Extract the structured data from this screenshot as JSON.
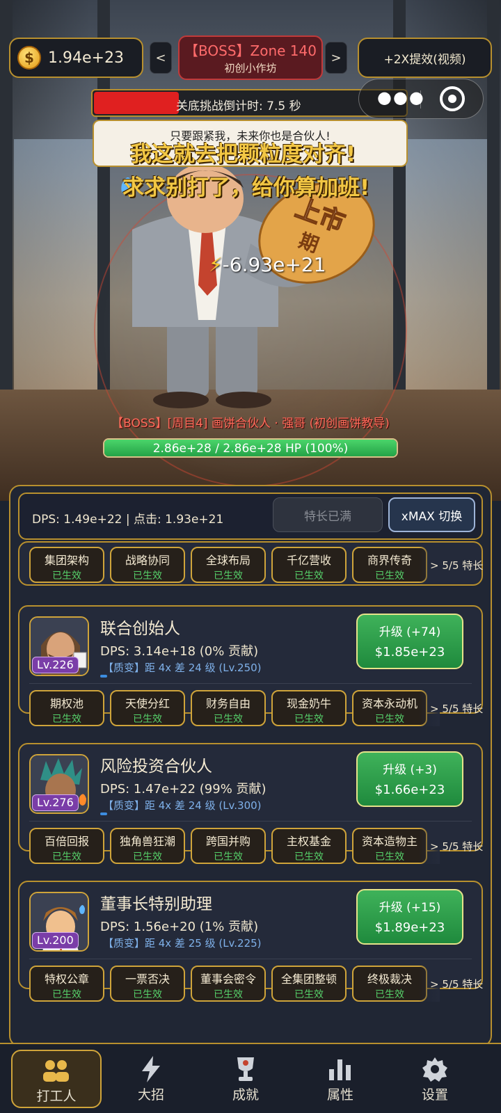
{
  "header": {
    "coins": "1.94e+23",
    "nav_prev": "<",
    "nav_next": ">",
    "zone_title": "【BOSS】Zone 140",
    "zone_subtitle": "初创小作坊",
    "video_boost": "+2X提效(视频)"
  },
  "timer": {
    "label": "关底挑战倒计时: 7.5 秒",
    "remaining_fraction": 0.27
  },
  "speech": {
    "bubble": "只要跟紧我，未来你也是合伙人!",
    "float_1": "我这就去把颗粒度对齐!",
    "float_2": "求求别打了，给你算加班!",
    "damage": "-6.93e+21"
  },
  "boss": {
    "name": "【BOSS】[周目4] 画饼合伙人 · 强哥 (初创画饼教导)",
    "hp_text": "2.86e+28 / 2.86e+28 HP (100%)",
    "hp_fraction": 1.0,
    "sign_text": "上市期"
  },
  "stats": {
    "dps_click": "DPS: 1.49e+22 | 点击: 1.93e+21",
    "maxed_label": "特长已满",
    "xmax_label": "xMAX 切换"
  },
  "top_perks": {
    "items": [
      {
        "name": "集团架构",
        "status": "已生效"
      },
      {
        "name": "战略协同",
        "status": "已生效"
      },
      {
        "name": "全球布局",
        "status": "已生效"
      },
      {
        "name": "千亿营收",
        "status": "已生效"
      },
      {
        "name": "商界传奇",
        "status": "已生效"
      }
    ],
    "count": "5/5 特长"
  },
  "units": [
    {
      "name": "联合创始人",
      "level": "Lv.226",
      "dps": "DPS: 3.14e+18 (0% 贡献)",
      "mutation": "【质变】距 4x 差 24 级 (Lv.250)",
      "upgrade_label": "升级 (+74)",
      "upgrade_cost": "$1.85e+23",
      "perks": [
        {
          "name": "期权池",
          "status": "已生效"
        },
        {
          "name": "天使分红",
          "status": "已生效"
        },
        {
          "name": "财务自由",
          "status": "已生效"
        },
        {
          "name": "现金奶牛",
          "status": "已生效"
        },
        {
          "name": "资本永动机",
          "status": "已生效"
        }
      ],
      "perk_count": "5/5 特长"
    },
    {
      "name": "风险投资合伙人",
      "level": "Lv.276",
      "dps": "DPS: 1.47e+22 (99% 贡献)",
      "mutation": "【质变】距 4x 差 24 级 (Lv.300)",
      "upgrade_label": "升级 (+3)",
      "upgrade_cost": "$1.66e+23",
      "perks": [
        {
          "name": "百倍回报",
          "status": "已生效"
        },
        {
          "name": "独角兽狂潮",
          "status": "已生效"
        },
        {
          "name": "跨国并购",
          "status": "已生效"
        },
        {
          "name": "主权基金",
          "status": "已生效"
        },
        {
          "name": "资本造物主",
          "status": "已生效"
        }
      ],
      "perk_count": "5/5 特长"
    },
    {
      "name": "董事长特别助理",
      "level": "Lv.200",
      "dps": "DPS: 1.56e+20 (1% 贡献)",
      "mutation": "【质变】距 4x 差 25 级 (Lv.225)",
      "upgrade_label": "升级 (+15)",
      "upgrade_cost": "$1.89e+23",
      "perks": [
        {
          "name": "特权公章",
          "status": "已生效"
        },
        {
          "name": "一票否决",
          "status": "已生效"
        },
        {
          "name": "董事会密令",
          "status": "已生效"
        },
        {
          "name": "全集团整顿",
          "status": "已生效"
        },
        {
          "name": "终极裁决",
          "status": "已生效"
        }
      ],
      "perk_count": "5/5 特长"
    }
  ],
  "tabs": [
    {
      "label": "打工人",
      "icon": "workers-icon",
      "active": true
    },
    {
      "label": "大招",
      "icon": "lightning-icon",
      "active": false
    },
    {
      "label": "成就",
      "icon": "trophy-icon",
      "active": false
    },
    {
      "label": "属性",
      "icon": "bar-chart-icon",
      "active": false
    },
    {
      "label": "设置",
      "icon": "gear-icon",
      "active": false
    }
  ],
  "colors": {
    "gold_border": "#b8902e",
    "boss_red": "#c13a3a",
    "upgrade_green": "#2f9c4b",
    "active_status": "#56d06a",
    "mutation_blue": "#7fb1ea",
    "level_purple": "#7a3da8"
  }
}
